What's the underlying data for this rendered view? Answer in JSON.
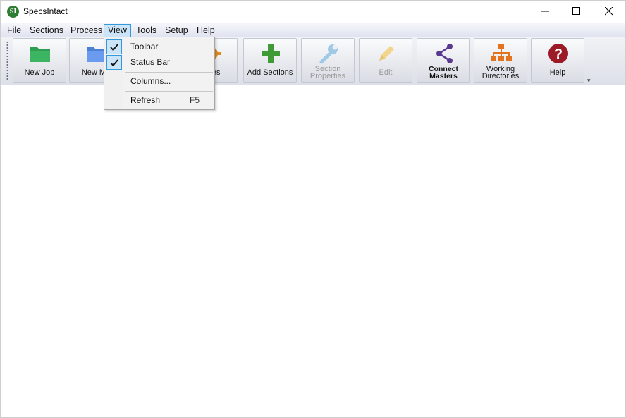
{
  "window": {
    "title": "SpecsIntact",
    "logo_text": "SI"
  },
  "menubar": {
    "items": [
      "File",
      "Sections",
      "Process",
      "View",
      "Tools",
      "Setup",
      "Help"
    ],
    "active": "View"
  },
  "toolbar": {
    "buttons": [
      {
        "label": "New Job",
        "icon": "green-folder-icon",
        "enabled": true
      },
      {
        "label": "New Ma",
        "icon": "blue-folder-icon",
        "enabled": true
      },
      {
        "label": "erties",
        "icon": "gear-icon",
        "enabled": true
      },
      {
        "label": "Add Sections",
        "icon": "green-plus-icon",
        "enabled": true
      },
      {
        "label_line1": "Section",
        "label_line2": "Properties",
        "icon": "wrench-icon",
        "enabled": false
      },
      {
        "label": "Edit",
        "icon": "pencil-icon",
        "enabled": false
      },
      {
        "label_line1": "Connect",
        "label_line2": "Masters",
        "icon": "share-icon",
        "enabled": true
      },
      {
        "label_line1": "Working",
        "label_line2": "Directories",
        "icon": "org-chart-icon",
        "enabled": true
      },
      {
        "label": "Help",
        "icon": "help-icon",
        "enabled": true
      }
    ],
    "overflow_glyph": "▾"
  },
  "view_menu": {
    "items": [
      {
        "label": "Toolbar",
        "checked": true
      },
      {
        "label": "Status Bar",
        "checked": true
      },
      {
        "label": "Columns..."
      },
      {
        "label": "Refresh",
        "shortcut": "F5"
      }
    ]
  },
  "colors": {
    "accent": "#3399dd",
    "menu_highlight": "#cce4f7",
    "logo": "#2f7d32"
  }
}
